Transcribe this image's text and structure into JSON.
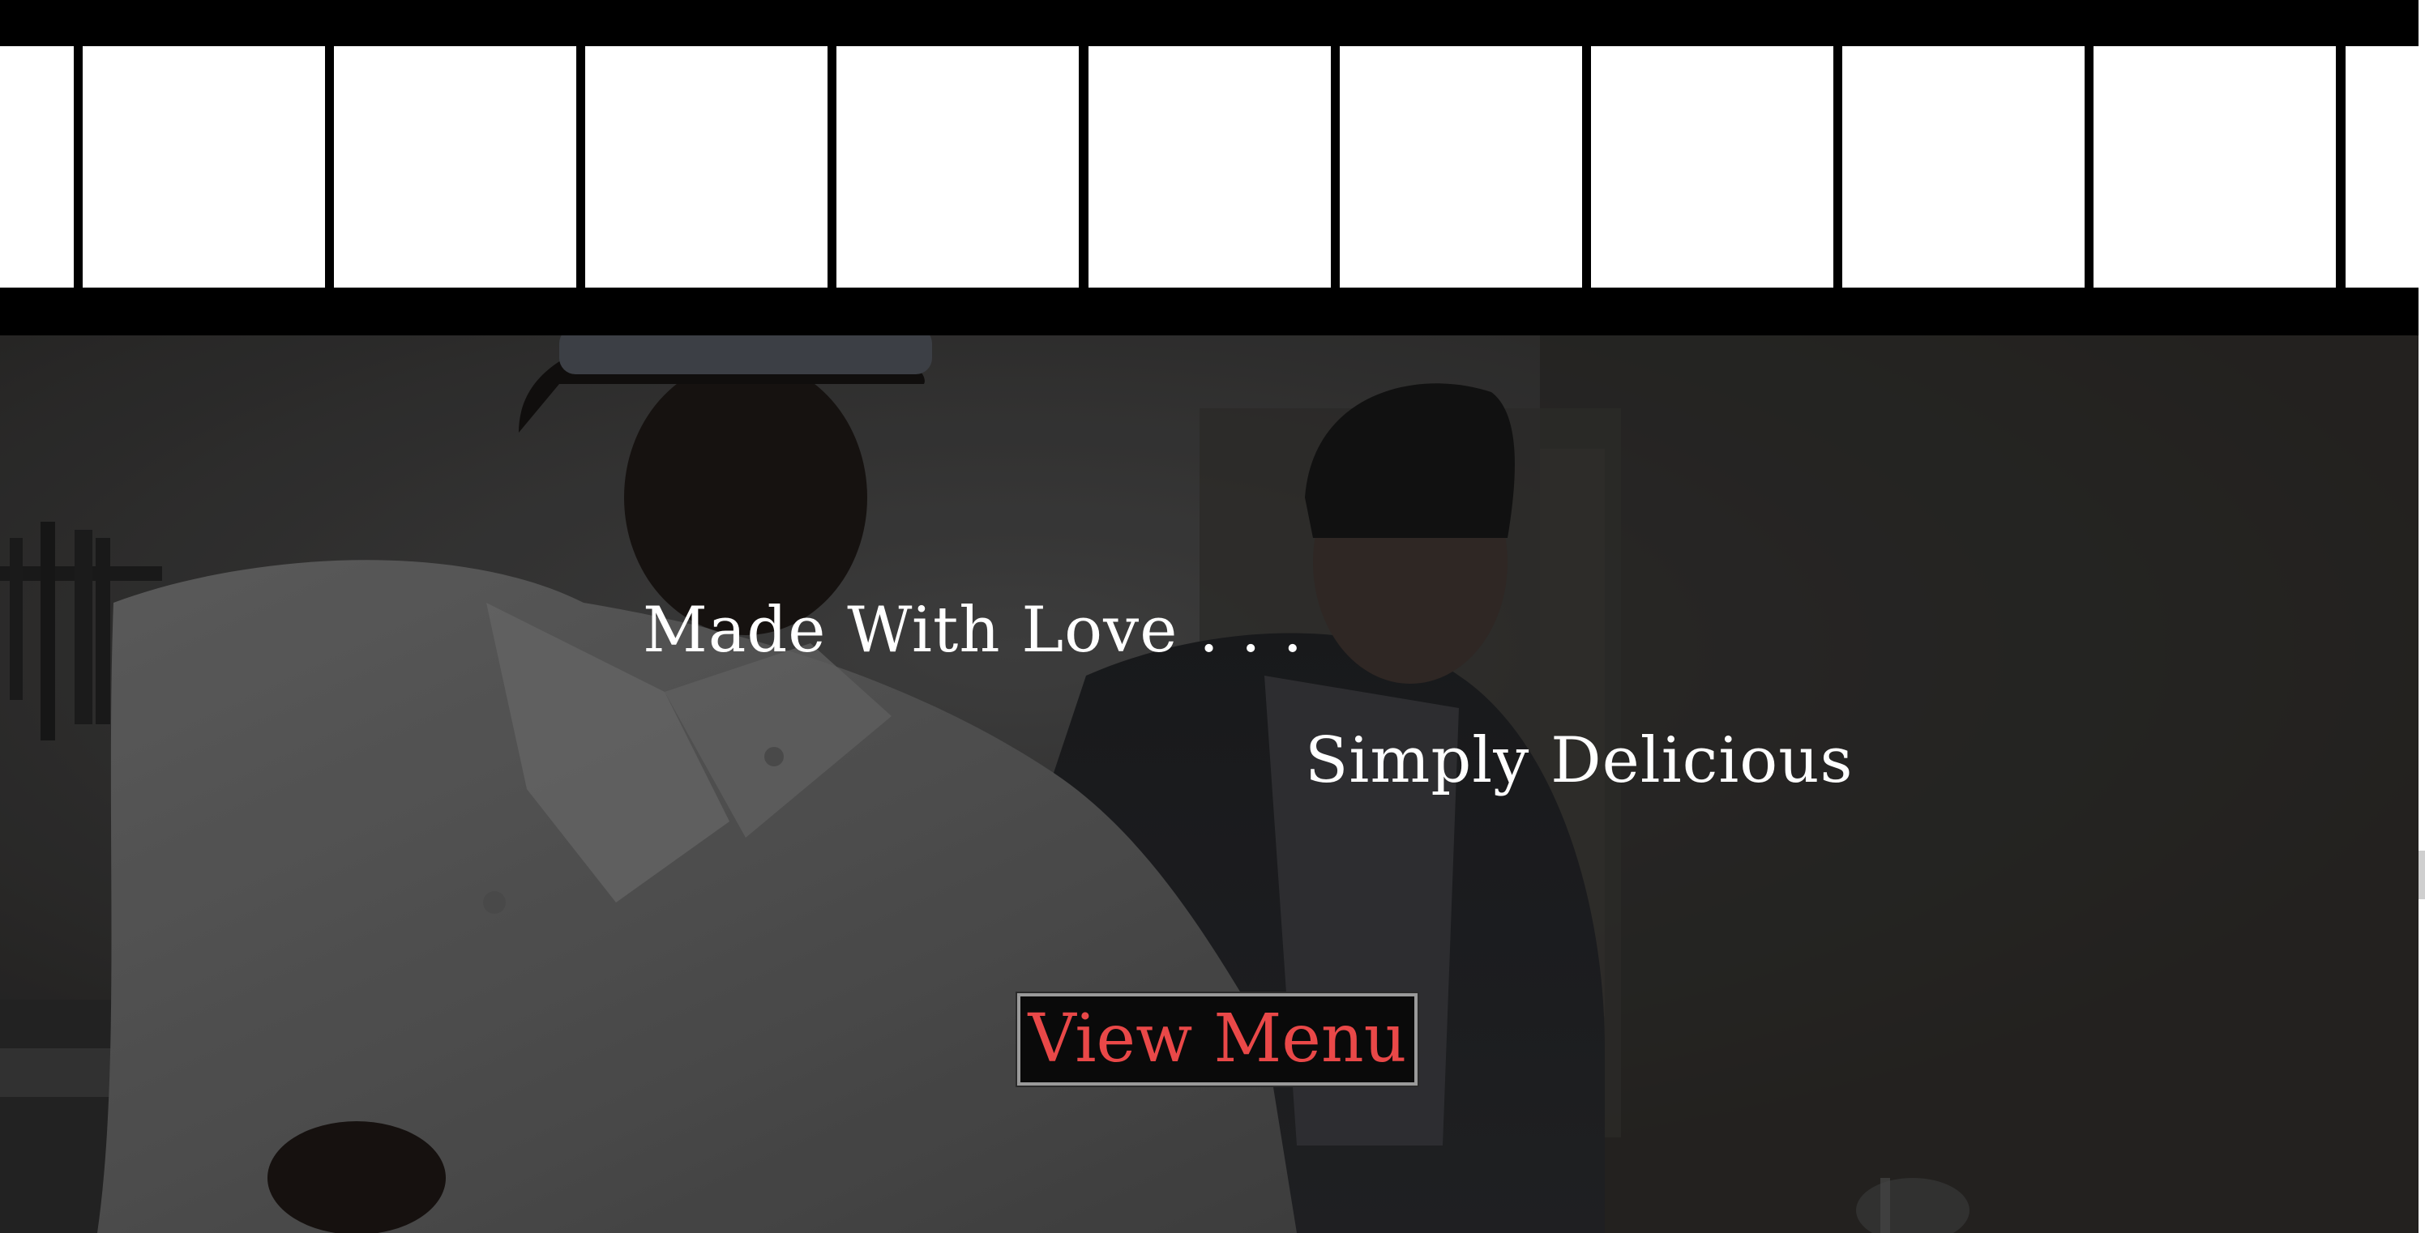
{
  "header": {
    "filmstrip_frame_count": 10
  },
  "hero": {
    "tagline_primary": "Made With Love . . .",
    "tagline_secondary": "Simply Delicious",
    "cta_label": "View Menu",
    "background_image": "chefs-in-kitchen-photo"
  },
  "colors": {
    "filmstrip_black": "#000000",
    "frame_white": "#ffffff",
    "tagline_text": "#ffffff",
    "cta_text": "#e94848",
    "cta_background": "#0a0a0a",
    "cta_border": "#9a9a9a"
  }
}
